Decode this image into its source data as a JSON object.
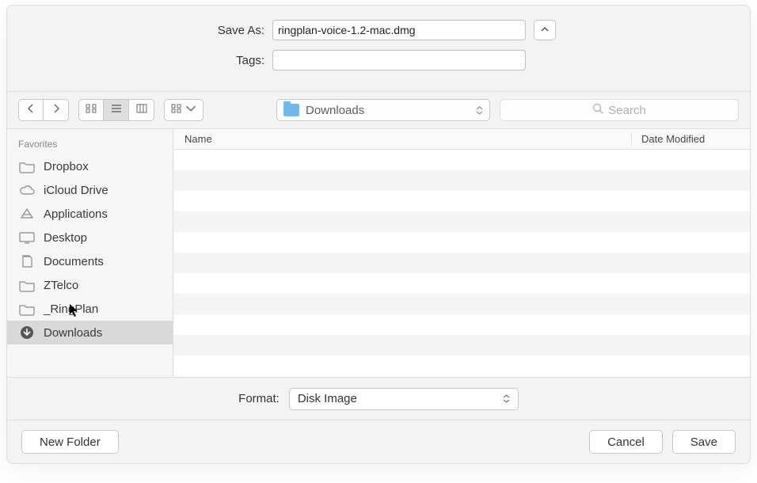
{
  "fields": {
    "save_as_label": "Save As:",
    "save_as_value": "ringplan-voice-1.2-mac.dmg",
    "tags_label": "Tags:",
    "tags_value": ""
  },
  "toolbar": {
    "path_label": "Downloads",
    "search_placeholder": "Search"
  },
  "sidebar": {
    "section": "Favorites",
    "items": [
      {
        "label": "Dropbox",
        "icon": "folder"
      },
      {
        "label": "iCloud Drive",
        "icon": "cloud"
      },
      {
        "label": "Applications",
        "icon": "apps"
      },
      {
        "label": "Desktop",
        "icon": "desktop"
      },
      {
        "label": "Documents",
        "icon": "docs"
      },
      {
        "label": "ZTelco",
        "icon": "folder"
      },
      {
        "label": "_RingPlan",
        "icon": "folder"
      },
      {
        "label": "Downloads",
        "icon": "download",
        "selected": true
      }
    ]
  },
  "list": {
    "col_name": "Name",
    "col_date": "Date Modified"
  },
  "format": {
    "label": "Format:",
    "value": "Disk Image"
  },
  "buttons": {
    "new_folder": "New Folder",
    "cancel": "Cancel",
    "save": "Save"
  }
}
